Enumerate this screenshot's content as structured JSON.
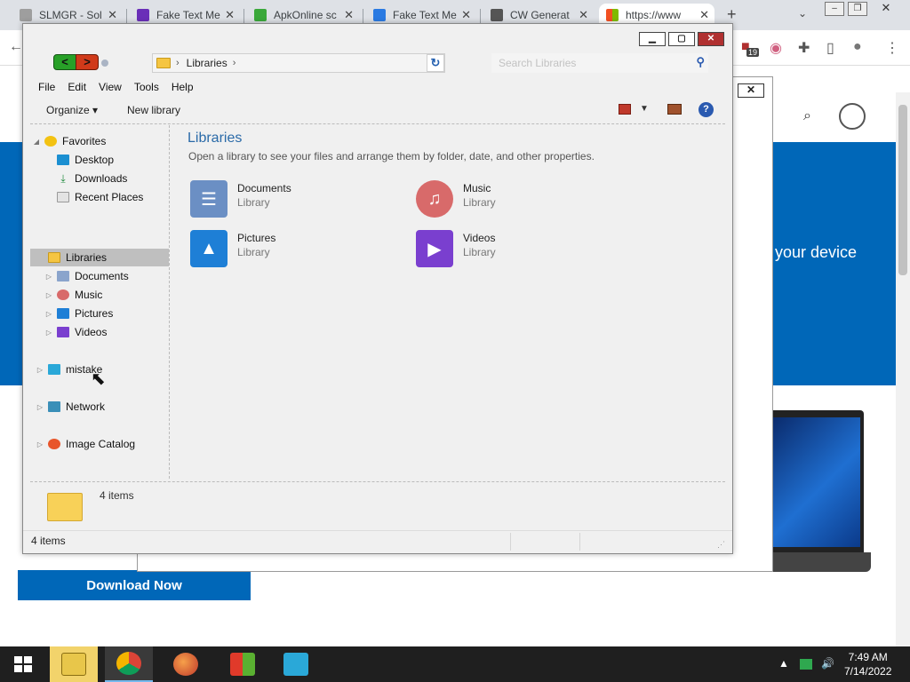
{
  "browser": {
    "tabs": [
      {
        "title": "SLMGR - Sol",
        "color": "#9e9e9e"
      },
      {
        "title": "Fake Text Me",
        "color": "#6a2fb8"
      },
      {
        "title": "ApkOnline sc",
        "color": "#3aa83a"
      },
      {
        "title": "Fake Text Me",
        "color": "#2a7ae2"
      },
      {
        "title": "CW Generat",
        "color": "#555555"
      },
      {
        "title": "https://www",
        "color": "#f25022"
      }
    ],
    "badge_count": "19",
    "hero_text": "your device",
    "download_button": "Download Now"
  },
  "explorer": {
    "address": {
      "crumb": "Libraries",
      "sep": "›"
    },
    "search_placeholder": "Search Libraries",
    "menu": [
      "File",
      "Edit",
      "View",
      "Tools",
      "Help"
    ],
    "commands": {
      "organize": "Organize ▾",
      "new_library": "New library"
    },
    "nav": {
      "favorites": {
        "label": "Favorites",
        "items": [
          "Desktop",
          "Downloads",
          "Recent Places"
        ]
      },
      "libraries": {
        "label": "Libraries",
        "items": [
          "Documents",
          "Music",
          "Pictures",
          "Videos"
        ]
      },
      "computer": "mistake",
      "network": "Network",
      "catalog": "Image Catalog"
    },
    "content": {
      "title": "Libraries",
      "subtitle": "Open a library to see your files and arrange them by folder, date, and other properties.",
      "libraries": [
        {
          "name": "Documents",
          "type": "Library",
          "icon": "documents-library-icon",
          "color": "#6b8fc4"
        },
        {
          "name": "Music",
          "type": "Library",
          "icon": "music-library-icon",
          "color": "#d86a6a"
        },
        {
          "name": "Pictures",
          "type": "Library",
          "icon": "pictures-library-icon",
          "color": "#1e7fd6"
        },
        {
          "name": "Videos",
          "type": "Library",
          "icon": "videos-library-icon",
          "color": "#7a3fcf"
        }
      ]
    },
    "details": {
      "count": "4 items"
    },
    "status": {
      "count": "4 items"
    }
  },
  "taskbar": {
    "time": "7:49 AM",
    "date": "7/14/2022"
  }
}
